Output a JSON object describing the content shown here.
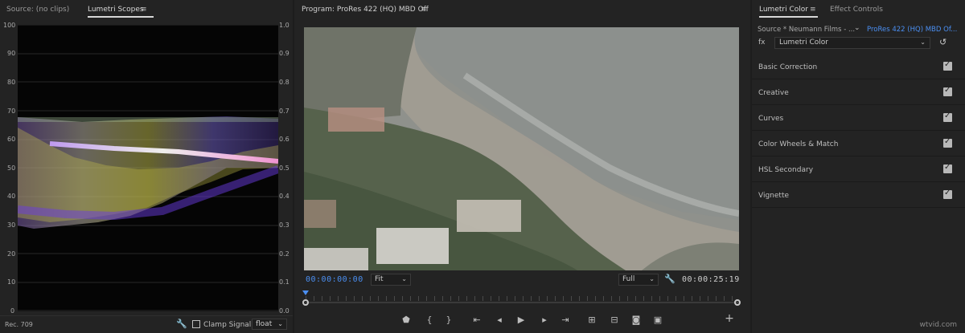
{
  "left": {
    "tabs": [
      {
        "label": "Source: (no clips)"
      },
      {
        "label": "Lumetri Scopes"
      }
    ],
    "scope": {
      "left_ticks": [
        "100",
        "90",
        "80",
        "70",
        "60",
        "50",
        "40",
        "30",
        "20",
        "10",
        "0"
      ],
      "right_ticks": [
        "1.0",
        "0.9",
        "0.8",
        "0.7",
        "0.6",
        "0.5",
        "0.4",
        "0.3",
        "0.2",
        "0.1",
        "0.0"
      ]
    },
    "bottom": {
      "rec": "Rec. 709",
      "clamp_label": "Clamp Signal",
      "float_label": "float"
    }
  },
  "center": {
    "title": "Program: ProRes 422 (HQ) MBD Off",
    "timecode_current": "00:00:00:00",
    "timecode_duration": "00:00:25:19",
    "zoom": "Fit",
    "resolution": "Full"
  },
  "right": {
    "tabs": [
      {
        "label": "Lumetri Color"
      },
      {
        "label": "Effect Controls"
      }
    ],
    "source_left": "Source * Neumann Films - ...",
    "source_right": "ProRes 422 (HQ) MBD Of...",
    "effect_select": "Lumetri Color",
    "sections": [
      {
        "label": "Basic Correction",
        "checked": true
      },
      {
        "label": "Creative",
        "checked": true
      },
      {
        "label": "Curves",
        "checked": true
      },
      {
        "label": "Color Wheels & Match",
        "checked": true
      },
      {
        "label": "HSL Secondary",
        "checked": true
      },
      {
        "label": "Vignette",
        "checked": true
      }
    ],
    "colors": {
      "link": "#4b8ff2"
    }
  },
  "watermark": "wtvid.com",
  "icons": [
    "menu-icon",
    "wrench-icon",
    "checkbox-icon",
    "chevron-down-icon",
    "marker-icon",
    "mark-in-icon",
    "mark-out-icon",
    "go-to-in-icon",
    "step-back-icon",
    "play-icon",
    "step-forward-icon",
    "go-to-out-icon",
    "insert-icon",
    "overwrite-icon",
    "camera-icon",
    "compare-icon",
    "plus-icon",
    "fx-icon",
    "reset-icon"
  ]
}
